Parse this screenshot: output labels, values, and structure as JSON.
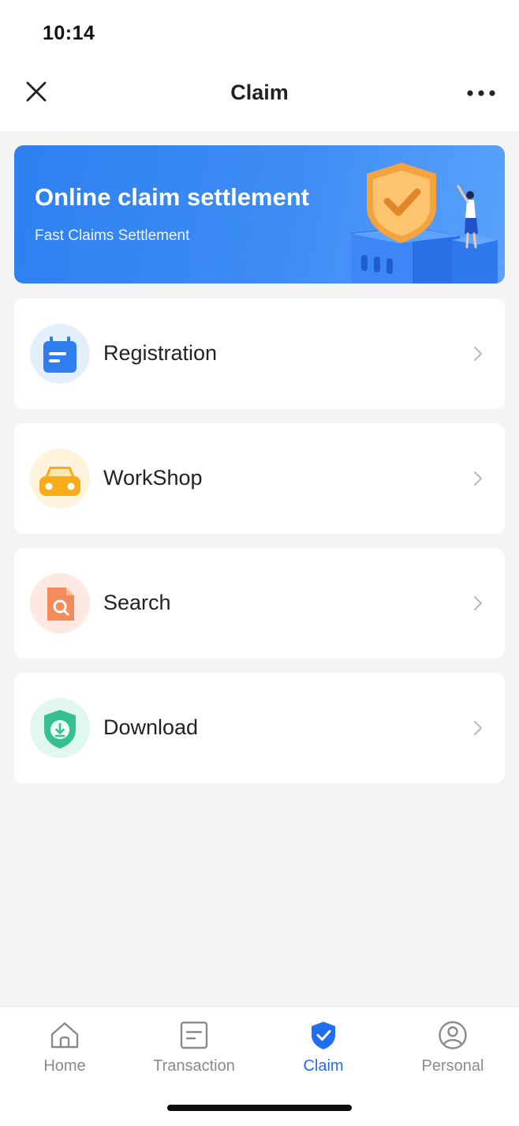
{
  "status": {
    "time": "10:14"
  },
  "nav": {
    "title": "Claim",
    "close_icon": "close-icon",
    "more_icon": "more-icon"
  },
  "banner": {
    "title": "Online claim settlement",
    "subtitle": "Fast Claims Settlement",
    "art": "shield-illustration"
  },
  "menu": [
    {
      "label": "Registration",
      "icon": "calendar-icon",
      "icon_bg": "#e3effd",
      "accent": "#2f7ef0"
    },
    {
      "label": "WorkShop",
      "icon": "car-icon",
      "icon_bg": "#fff3dc",
      "accent": "#f8ac1c"
    },
    {
      "label": "Search",
      "icon": "search-document-icon",
      "icon_bg": "#fde9e1",
      "accent": "#f58a5b"
    },
    {
      "label": "Download",
      "icon": "download-shield-icon",
      "icon_bg": "#e1f6ee",
      "accent": "#36c08f"
    }
  ],
  "tabs": [
    {
      "label": "Home",
      "icon": "home-icon",
      "active": false
    },
    {
      "label": "Transaction",
      "icon": "document-icon",
      "active": false
    },
    {
      "label": "Claim",
      "icon": "shield-check-icon",
      "active": true
    },
    {
      "label": "Personal",
      "icon": "user-icon",
      "active": false
    }
  ],
  "colors": {
    "primary": "#1f6ff0",
    "banner": "#3a88f4",
    "inactive": "#8a8a8a",
    "background": "#f4f4f4"
  }
}
